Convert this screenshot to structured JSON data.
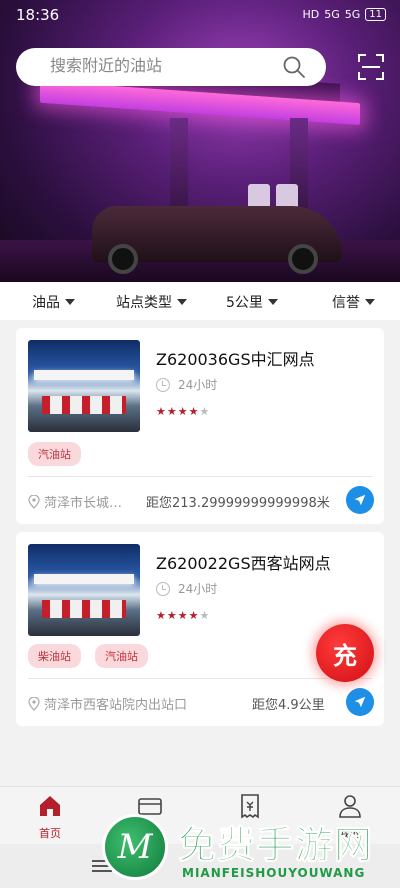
{
  "status_bar": {
    "time": "18:36",
    "indicators": [
      "HD",
      "5G",
      "5G"
    ],
    "battery": "11"
  },
  "search": {
    "placeholder": "搜索附近的油站",
    "value": ""
  },
  "filters": [
    {
      "label": "油品"
    },
    {
      "label": "站点类型"
    },
    {
      "label": "5公里"
    },
    {
      "label": "信誉"
    }
  ],
  "stations": [
    {
      "name": "Z620036GS中汇网点",
      "hours": "24小时",
      "rating": 4,
      "rating_max": 5,
      "tags": [
        "汽油站"
      ],
      "address": "菏泽市长城…",
      "distance": "距您213.29999999999998米"
    },
    {
      "name": "Z620022GS西客站网点",
      "hours": "24小时",
      "rating": 4,
      "rating_max": 5,
      "tags": [
        "柴油站",
        "汽油站"
      ],
      "address": "菏泽市西客站院内出站口",
      "distance": "距您4.9公里"
    }
  ],
  "fab": {
    "label": "充"
  },
  "tabbar": [
    {
      "label": "首页",
      "icon": "home-icon",
      "active": true
    },
    {
      "label": "",
      "icon": "card-icon"
    },
    {
      "label": "",
      "icon": "receipt-icon"
    },
    {
      "label": "我的",
      "icon": "user-icon"
    }
  ],
  "watermark": {
    "title": "免费手游网",
    "subtitle": "MIANFEISHOUYOUWANG"
  },
  "colors": {
    "accent": "#b3202b",
    "tag_bg": "#f9d9dc",
    "nav_blue": "#1e8fe6"
  }
}
